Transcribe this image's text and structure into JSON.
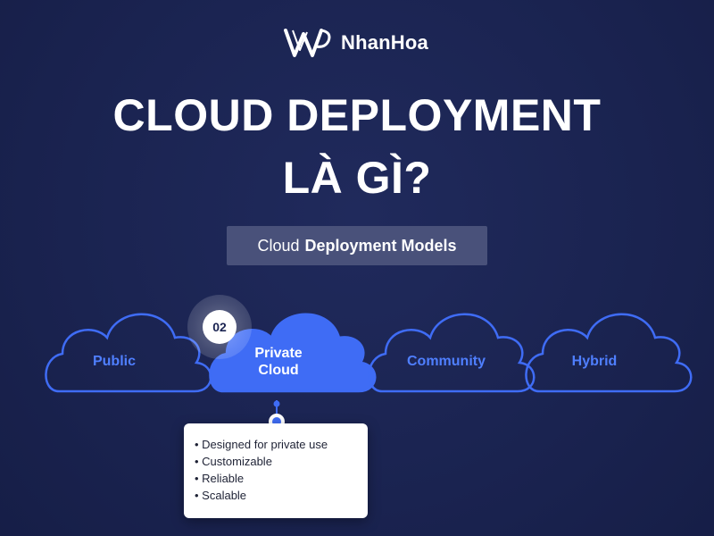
{
  "brand": {
    "name": "NhanHoa",
    "logo_icon": "nhanhoa-logo-icon"
  },
  "title": {
    "line1": "CLOUD DEPLOYMENT",
    "line2": "LÀ GÌ?"
  },
  "models_pill": {
    "regular": "Cloud",
    "bold": "Deployment Models"
  },
  "models": [
    {
      "label": "Public",
      "active": false
    },
    {
      "label_line1": "Private",
      "label_line2": "Cloud",
      "active": true,
      "badge": "02"
    },
    {
      "label": "Community",
      "active": false
    },
    {
      "label": "Hybrid",
      "active": false
    }
  ],
  "details": [
    "Designed for private use",
    "Customizable",
    "Reliable",
    "Scalable"
  ],
  "colors": {
    "background": "#1b2452",
    "accent": "#3f6cf5",
    "outline": "#3f6cf5",
    "text": "#ffffff"
  }
}
